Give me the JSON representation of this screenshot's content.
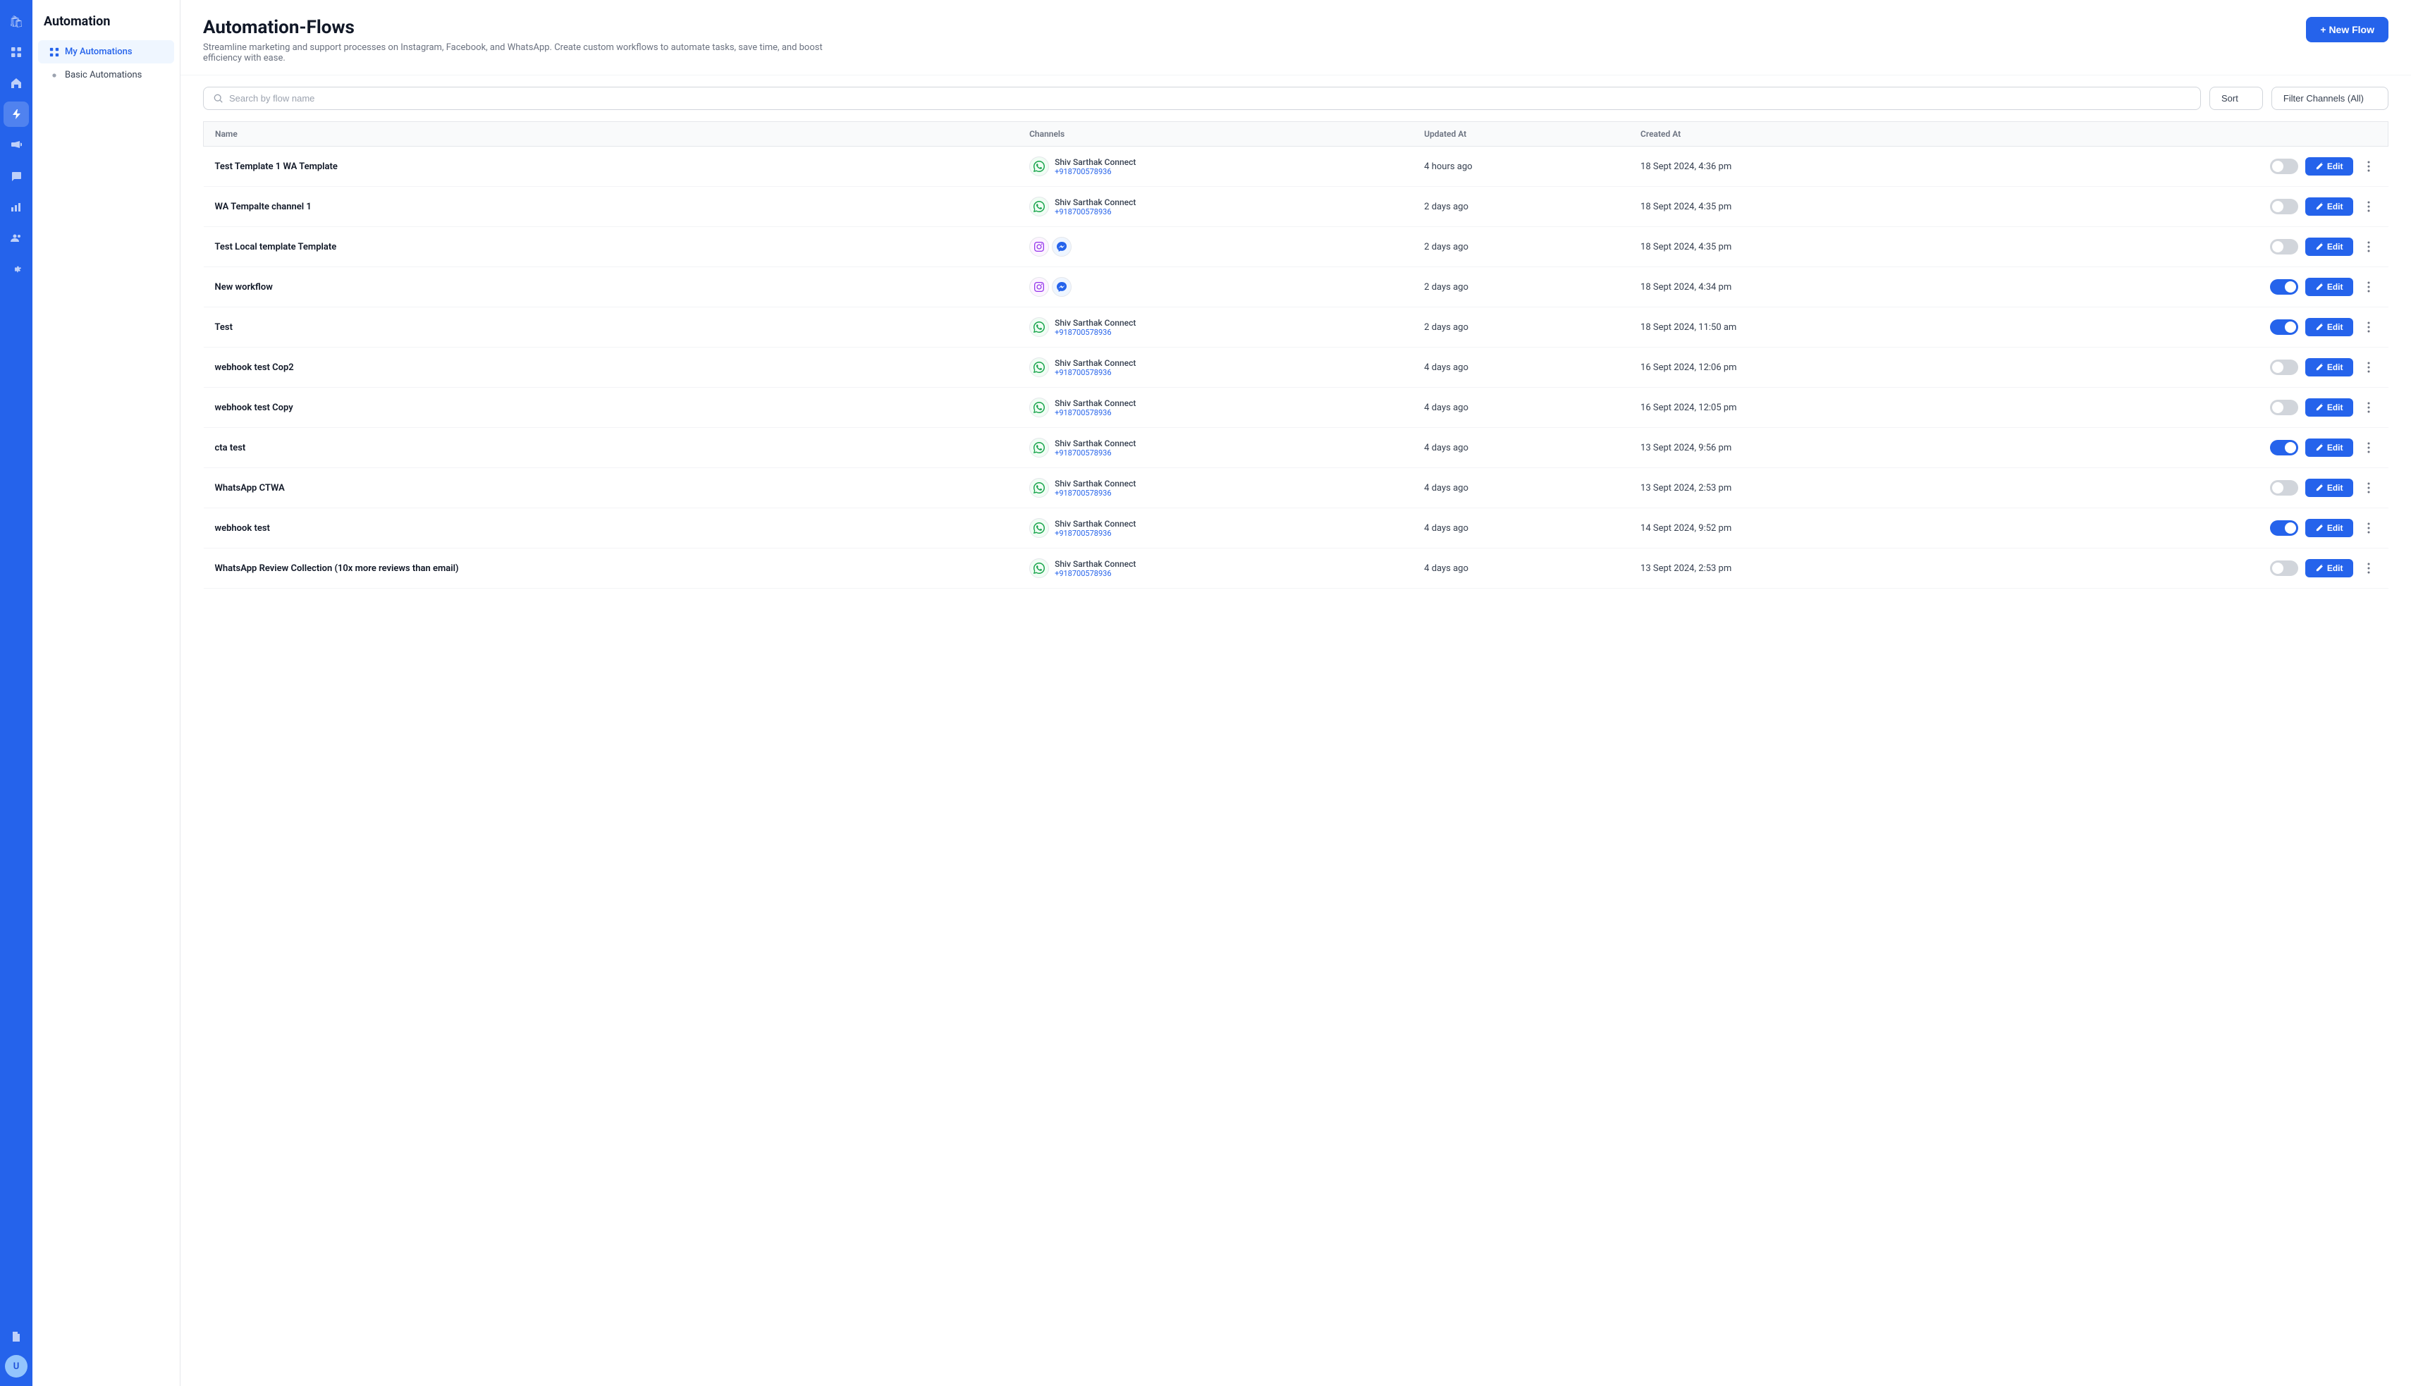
{
  "sidebar": {
    "icons": [
      {
        "name": "bag-icon",
        "symbol": "🛍",
        "active": false
      },
      {
        "name": "home-icon",
        "symbol": "⊡",
        "active": false
      },
      {
        "name": "home2-icon",
        "symbol": "⌂",
        "active": false
      },
      {
        "name": "lightning-icon",
        "symbol": "⚡",
        "active": true
      },
      {
        "name": "megaphone-icon",
        "symbol": "📣",
        "active": false
      },
      {
        "name": "chat-icon",
        "symbol": "💬",
        "active": false
      },
      {
        "name": "chart-icon",
        "symbol": "📊",
        "active": false
      },
      {
        "name": "users-icon",
        "symbol": "👥",
        "active": false
      },
      {
        "name": "gear-icon",
        "symbol": "⚙",
        "active": false
      },
      {
        "name": "doc-icon",
        "symbol": "📋",
        "active": false
      }
    ],
    "avatar_initials": "U"
  },
  "nav": {
    "title": "Automation",
    "items": [
      {
        "id": "my-automations",
        "label": "My Automations",
        "active": true
      },
      {
        "id": "basic-automations",
        "label": "Basic Automations",
        "active": false
      }
    ]
  },
  "header": {
    "title": "Automation-Flows",
    "subtitle": "Streamline marketing and support processes on Instagram, Facebook, and WhatsApp. Create custom workflows to automate tasks, save time, and boost efficiency with ease.",
    "new_flow_label": "+ New Flow"
  },
  "toolbar": {
    "search_placeholder": "Search by flow name",
    "sort_label": "Sort",
    "filter_label": "Filter Channels (All)"
  },
  "table": {
    "columns": [
      "Name",
      "Channels",
      "Updated At",
      "Created At"
    ],
    "rows": [
      {
        "name": "Test Template 1 WA Template",
        "channel_type": "wa",
        "channel_name": "Shiv Sarthak Connect",
        "channel_num": "+918700578936",
        "updated": "4 hours ago",
        "created": "18 Sept 2024, 4:36 pm",
        "active": false
      },
      {
        "name": "WA Tempalte channel 1",
        "channel_type": "wa",
        "channel_name": "Shiv Sarthak Connect",
        "channel_num": "+918700578936",
        "updated": "2 days ago",
        "created": "18 Sept 2024, 4:35 pm",
        "active": false
      },
      {
        "name": "Test Local template Template",
        "channel_type": "ig_fb",
        "channel_name": "",
        "channel_num": "",
        "updated": "2 days ago",
        "created": "18 Sept 2024, 4:35 pm",
        "active": false
      },
      {
        "name": "New workflow",
        "channel_type": "ig_fb",
        "channel_name": "",
        "channel_num": "",
        "updated": "2 days ago",
        "created": "18 Sept 2024, 4:34 pm",
        "active": true
      },
      {
        "name": "Test",
        "channel_type": "wa",
        "channel_name": "Shiv Sarthak Connect",
        "channel_num": "+918700578936",
        "updated": "2 days ago",
        "created": "18 Sept 2024, 11:50 am",
        "active": true
      },
      {
        "name": "webhook test Cop2",
        "channel_type": "wa",
        "channel_name": "Shiv Sarthak Connect",
        "channel_num": "+918700578936",
        "updated": "4 days ago",
        "created": "16 Sept 2024, 12:06 pm",
        "active": false
      },
      {
        "name": "webhook test Copy",
        "channel_type": "wa",
        "channel_name": "Shiv Sarthak Connect",
        "channel_num": "+918700578936",
        "updated": "4 days ago",
        "created": "16 Sept 2024, 12:05 pm",
        "active": false
      },
      {
        "name": "cta test",
        "channel_type": "wa",
        "channel_name": "Shiv Sarthak Connect",
        "channel_num": "+918700578936",
        "updated": "4 days ago",
        "created": "13 Sept 2024, 9:56 pm",
        "active": true
      },
      {
        "name": "WhatsApp CTWA",
        "channel_type": "wa",
        "channel_name": "Shiv Sarthak Connect",
        "channel_num": "+918700578936",
        "updated": "4 days ago",
        "created": "13 Sept 2024, 2:53 pm",
        "active": false
      },
      {
        "name": "webhook test",
        "channel_type": "wa",
        "channel_name": "Shiv Sarthak Connect",
        "channel_num": "+918700578936",
        "updated": "4 days ago",
        "created": "14 Sept 2024, 9:52 pm",
        "active": true
      },
      {
        "name": "WhatsApp Review Collection (10x more reviews than email)",
        "channel_type": "wa",
        "channel_name": "Shiv Sarthak Connect",
        "channel_num": "+918700578936",
        "updated": "4 days ago",
        "created": "13 Sept 2024, 2:53 pm",
        "active": false
      }
    ],
    "edit_label": "Edit"
  },
  "colors": {
    "primary": "#2563eb",
    "active_toggle": "#2563eb",
    "inactive_toggle": "#d1d5db"
  }
}
